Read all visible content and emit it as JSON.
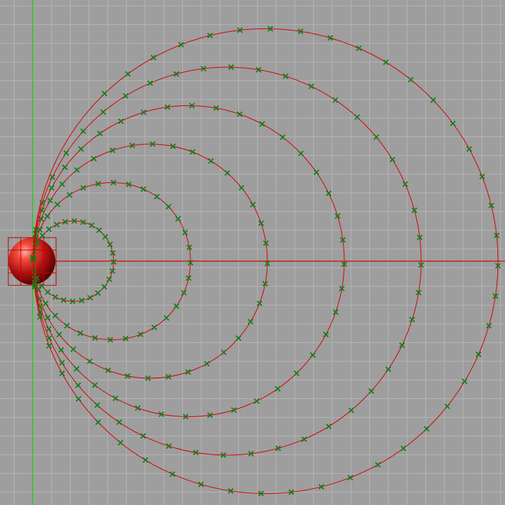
{
  "viewport": {
    "background_color": "#9e9e9e",
    "grid_color": "#b4b4b4"
  },
  "axes": {
    "x_axis_color": "#c81e1e",
    "y_axis_color": "#1ec81e"
  },
  "curves": {
    "line_color": "#d40000",
    "marker_color": "#1a7a1a",
    "marker_shape": "x-cross",
    "count": 6
  },
  "selected_object": {
    "type": "sphere",
    "icon": "sphere-icon",
    "color": "#d01818",
    "selection_box_color": "#c00000"
  }
}
